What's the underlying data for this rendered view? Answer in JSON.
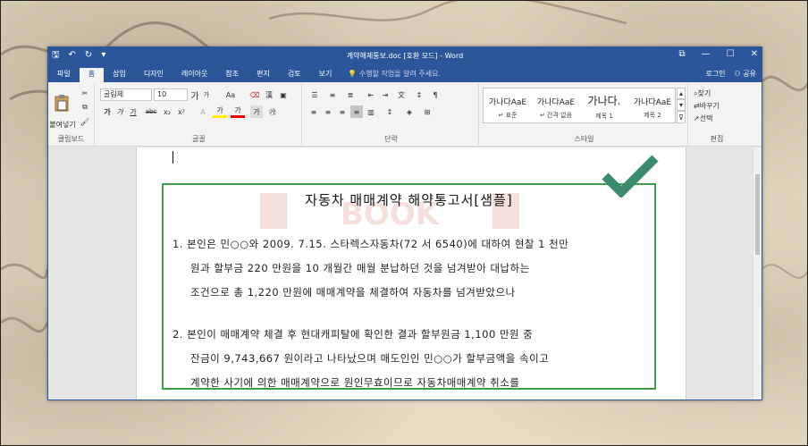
{
  "window": {
    "title": "계약해제통보.doc [호환 모드] - Word",
    "controls": [
      "⧉",
      "—",
      "☐",
      "✕"
    ]
  },
  "qat": {
    "save": "🖫",
    "undo": "↶",
    "redo": "↻",
    "customize": "▾"
  },
  "tabs": [
    "파일",
    "홈",
    "삽입",
    "디자인",
    "레이아웃",
    "참조",
    "편지",
    "검토",
    "보기"
  ],
  "active_tab": "홈",
  "tellme": "수행할 작업을 알려 주세요.",
  "account": {
    "login": "로그인",
    "share": "공유"
  },
  "ribbon": {
    "clipboard": {
      "label": "클립보드",
      "paste": "붙여넣기"
    },
    "font": {
      "label": "글꼴",
      "name": "굴림체",
      "size": "10",
      "aa": "Aa",
      "hanja": "漢",
      "grow": "가",
      "shrink": "가",
      "bold": "가",
      "italic": "가",
      "underline": "가",
      "strike": "abc",
      "sub": "x₂",
      "sup": "x²",
      "highlight": "가",
      "color": "가"
    },
    "paragraph": {
      "label": "단락"
    },
    "styles": {
      "label": "스타일",
      "items": [
        {
          "preview": "가나다AaE",
          "name": "↵ 표준"
        },
        {
          "preview": "가나다AaE",
          "name": "↵ 간격 없음"
        },
        {
          "preview": "가나다.",
          "name": "제목 1"
        },
        {
          "preview": "가나다AaE",
          "name": "제목 2"
        }
      ]
    },
    "editing": {
      "label": "편집",
      "find": "찾기",
      "replace": "바꾸기",
      "select": "선택"
    }
  },
  "document": {
    "title": "자동차 매매계약 해약통고서[샘플]",
    "para1": [
      "1. 본인은 민○○와 2009. 7.15. 스타렉스자동차(72 서 6540)에 대하여 현찰 1 천만",
      "원과 할부금 220 만원을 10 개월간 매월 분납하던 것을 넘겨받아 대납하는",
      "조건으로 총 1,220 만원에 매매계약을 체결하여 자동차를 넘겨받았으나"
    ],
    "para2": [
      "2. 본인이 매매계약 체결 후 현대캐피탈에 확인한 결과 할부원금 1,100 만원 중",
      "잔금이 9,743,667 원이라고 나타났으며 매도인인 민○○가 할부금액을 속이고",
      "계약한 사기에 의한 매매계약으로 원인무효이므로 자동차매매계약 취소를"
    ]
  },
  "watermark": "BOOK",
  "colors": {
    "accent": "#2b579a",
    "check": "#3d8b6e",
    "box": "#3aa04a"
  }
}
